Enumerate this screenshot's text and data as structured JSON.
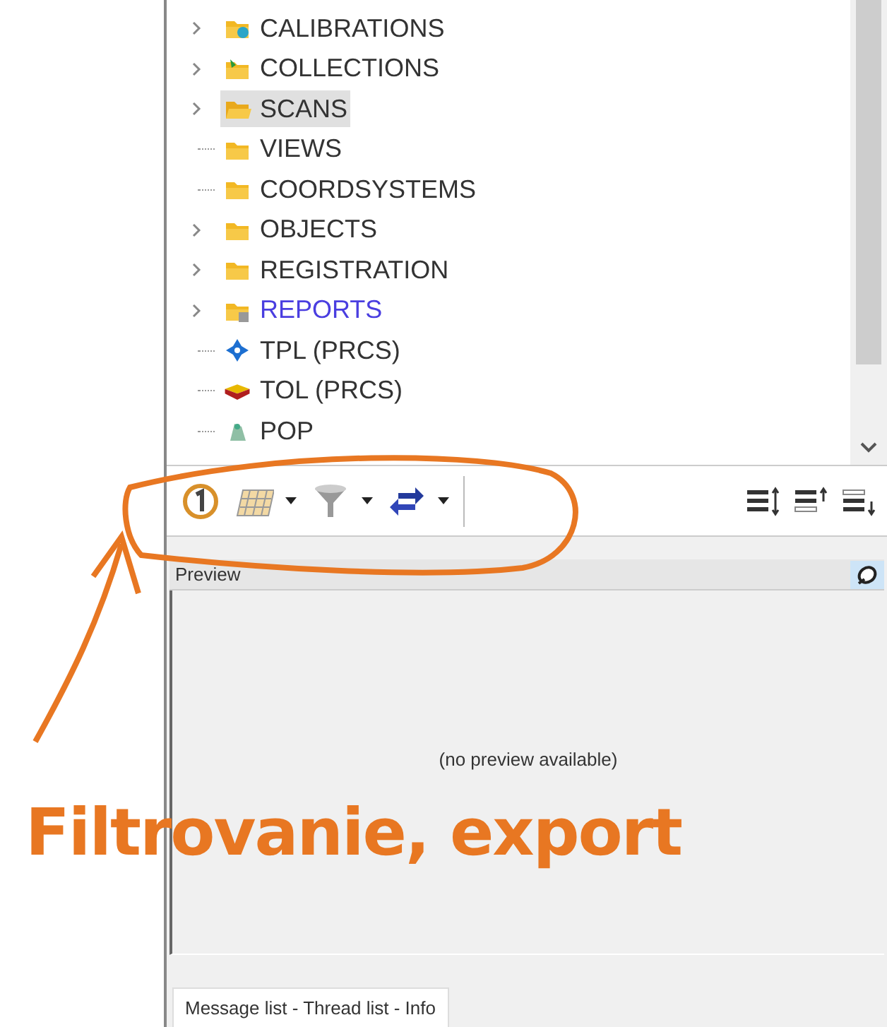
{
  "tree": {
    "items": [
      {
        "label": "CALIBRATIONS",
        "kind": "calibrations",
        "expandable": true,
        "selected": false,
        "highlighted": false
      },
      {
        "label": "COLLECTIONS",
        "kind": "collections",
        "expandable": true,
        "selected": false,
        "highlighted": false
      },
      {
        "label": "SCANS",
        "kind": "folder-open",
        "expandable": true,
        "selected": true,
        "highlighted": false
      },
      {
        "label": "VIEWS",
        "kind": "folder",
        "expandable": false,
        "selected": false,
        "highlighted": false
      },
      {
        "label": "COORDSYSTEMS",
        "kind": "folder",
        "expandable": false,
        "selected": false,
        "highlighted": false
      },
      {
        "label": "OBJECTS",
        "kind": "folder",
        "expandable": true,
        "selected": false,
        "highlighted": false
      },
      {
        "label": "REGISTRATION",
        "kind": "folder",
        "expandable": true,
        "selected": false,
        "highlighted": false
      },
      {
        "label": "REPORTS",
        "kind": "reports",
        "expandable": true,
        "selected": false,
        "highlighted": true
      },
      {
        "label": "TPL (PRCS)",
        "kind": "tpl",
        "expandable": false,
        "selected": false,
        "highlighted": false
      },
      {
        "label": "TOL (PRCS)",
        "kind": "tol",
        "expandable": false,
        "selected": false,
        "highlighted": false
      },
      {
        "label": "POP",
        "kind": "pop",
        "expandable": false,
        "selected": false,
        "highlighted": false
      }
    ]
  },
  "toolbar": {
    "left": [
      {
        "kind": "counter",
        "dropdown": false
      },
      {
        "kind": "grid",
        "dropdown": true
      },
      {
        "kind": "filter",
        "dropdown": true
      },
      {
        "kind": "transfer",
        "dropdown": true
      }
    ],
    "right": [
      {
        "kind": "sort-both"
      },
      {
        "kind": "sort-up"
      },
      {
        "kind": "sort-down"
      }
    ]
  },
  "preview": {
    "title": "Preview",
    "message": "(no preview available)"
  },
  "bottom_tab": {
    "label": "Message list - Thread list - Info",
    "selected": true
  },
  "annotation": {
    "text": "Filtrovanie, export"
  }
}
